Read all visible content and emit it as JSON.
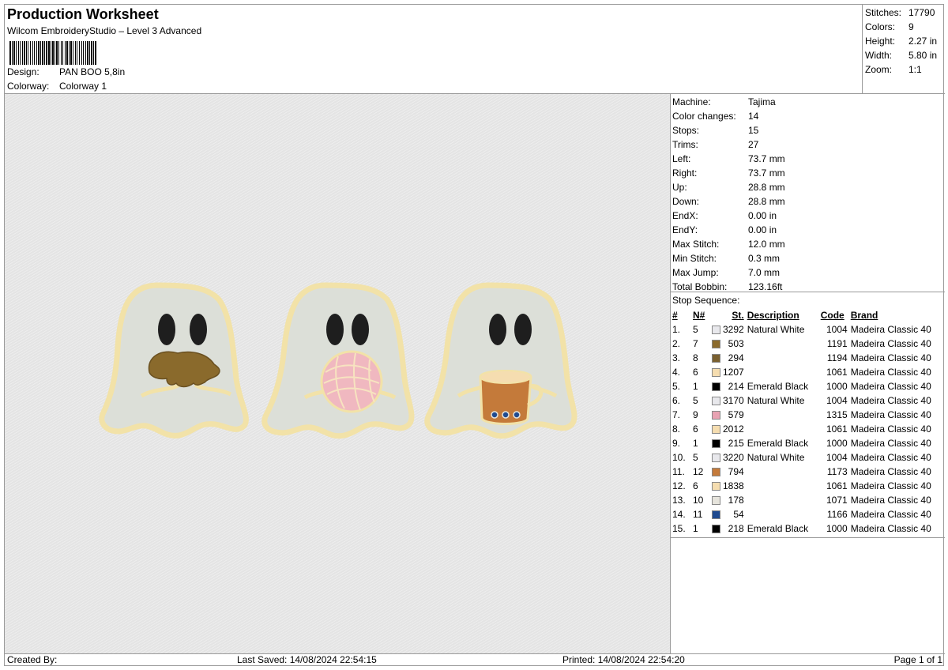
{
  "header": {
    "title": "Production Worksheet",
    "subtitle": "Wilcom EmbroideryStudio – Level 3 Advanced",
    "design_label": "Design:",
    "design_value": "PAN BOO 5,8in",
    "colorway_label": "Colorway:",
    "colorway_value": "Colorway 1"
  },
  "summary": [
    {
      "label": "Stitches:",
      "value": "17790"
    },
    {
      "label": "Colors:",
      "value": "9"
    },
    {
      "label": "Height:",
      "value": "2.27 in"
    },
    {
      "label": "Width:",
      "value": "5.80 in"
    },
    {
      "label": "Zoom:",
      "value": "1:1"
    }
  ],
  "specs": [
    {
      "label": "Machine:",
      "value": "Tajima"
    },
    {
      "label": "Color changes:",
      "value": "14"
    },
    {
      "label": "Stops:",
      "value": "15"
    },
    {
      "label": "Trims:",
      "value": "27"
    },
    {
      "label": "Left:",
      "value": "73.7 mm"
    },
    {
      "label": "Right:",
      "value": "73.7 mm"
    },
    {
      "label": "Up:",
      "value": "28.8 mm"
    },
    {
      "label": "Down:",
      "value": "28.8 mm"
    },
    {
      "label": "EndX:",
      "value": "0.00 in"
    },
    {
      "label": "EndY:",
      "value": "0.00 in"
    },
    {
      "label": "Max Stitch:",
      "value": "12.0 mm"
    },
    {
      "label": "Min Stitch:",
      "value": "0.3 mm"
    },
    {
      "label": "Max Jump:",
      "value": "7.0 mm"
    },
    {
      "label": "Total Bobbin:",
      "value": "123.16ft"
    }
  ],
  "stop_sequence": {
    "caption": "Stop Sequence:",
    "columns": [
      "#",
      "N#",
      "St.",
      "Description",
      "Code",
      "Brand"
    ],
    "rows": [
      {
        "idx": "1.",
        "n": "5",
        "color": "#e8e8ec",
        "st": "3292",
        "desc": "Natural White",
        "code": "1004",
        "brand": "Madeira Classic 40"
      },
      {
        "idx": "2.",
        "n": "7",
        "color": "#8a6a2c",
        "st": "503",
        "desc": "",
        "code": "1191",
        "brand": "Madeira Classic 40"
      },
      {
        "idx": "3.",
        "n": "8",
        "color": "#7a6030",
        "st": "294",
        "desc": "",
        "code": "1194",
        "brand": "Madeira Classic 40"
      },
      {
        "idx": "4.",
        "n": "6",
        "color": "#f5ddb0",
        "st": "1207",
        "desc": "",
        "code": "1061",
        "brand": "Madeira Classic 40"
      },
      {
        "idx": "5.",
        "n": "1",
        "color": "#000000",
        "st": "214",
        "desc": "Emerald Black",
        "code": "1000",
        "brand": "Madeira Classic 40"
      },
      {
        "idx": "6.",
        "n": "5",
        "color": "#e8e8ec",
        "st": "3170",
        "desc": "Natural White",
        "code": "1004",
        "brand": "Madeira Classic 40"
      },
      {
        "idx": "7.",
        "n": "9",
        "color": "#e8a2b2",
        "st": "579",
        "desc": "",
        "code": "1315",
        "brand": "Madeira Classic 40"
      },
      {
        "idx": "8.",
        "n": "6",
        "color": "#f5ddb0",
        "st": "2012",
        "desc": "",
        "code": "1061",
        "brand": "Madeira Classic 40"
      },
      {
        "idx": "9.",
        "n": "1",
        "color": "#000000",
        "st": "215",
        "desc": "Emerald Black",
        "code": "1000",
        "brand": "Madeira Classic 40"
      },
      {
        "idx": "10.",
        "n": "5",
        "color": "#e8e8ec",
        "st": "3220",
        "desc": "Natural White",
        "code": "1004",
        "brand": "Madeira Classic 40"
      },
      {
        "idx": "11.",
        "n": "12",
        "color": "#c47a3a",
        "st": "794",
        "desc": "",
        "code": "1173",
        "brand": "Madeira Classic 40"
      },
      {
        "idx": "12.",
        "n": "6",
        "color": "#f5ddb0",
        "st": "1838",
        "desc": "",
        "code": "1061",
        "brand": "Madeira Classic 40"
      },
      {
        "idx": "13.",
        "n": "10",
        "color": "#e6e4dc",
        "st": "178",
        "desc": "",
        "code": "1071",
        "brand": "Madeira Classic 40"
      },
      {
        "idx": "14.",
        "n": "11",
        "color": "#1f4a90",
        "st": "54",
        "desc": "",
        "code": "1166",
        "brand": "Madeira Classic 40"
      },
      {
        "idx": "15.",
        "n": "1",
        "color": "#000000",
        "st": "218",
        "desc": "Emerald Black",
        "code": "1000",
        "brand": "Madeira Classic 40"
      }
    ]
  },
  "footer": {
    "created_by": "Created By:",
    "last_saved": "Last Saved: 14/08/2024 22:54:15",
    "printed": "Printed: 14/08/2024 22:54:20",
    "page": "Page 1 of 1"
  },
  "colors": {
    "ghost_fill": "#dcdfd8",
    "ghost_outline": "#f2e2a8",
    "eye": "#1e1e1e",
    "pig_bread": "#8a6a2c",
    "concha": "#f0b8c0",
    "mug": "#c47a3a",
    "canvas": "#e4e4e4"
  }
}
